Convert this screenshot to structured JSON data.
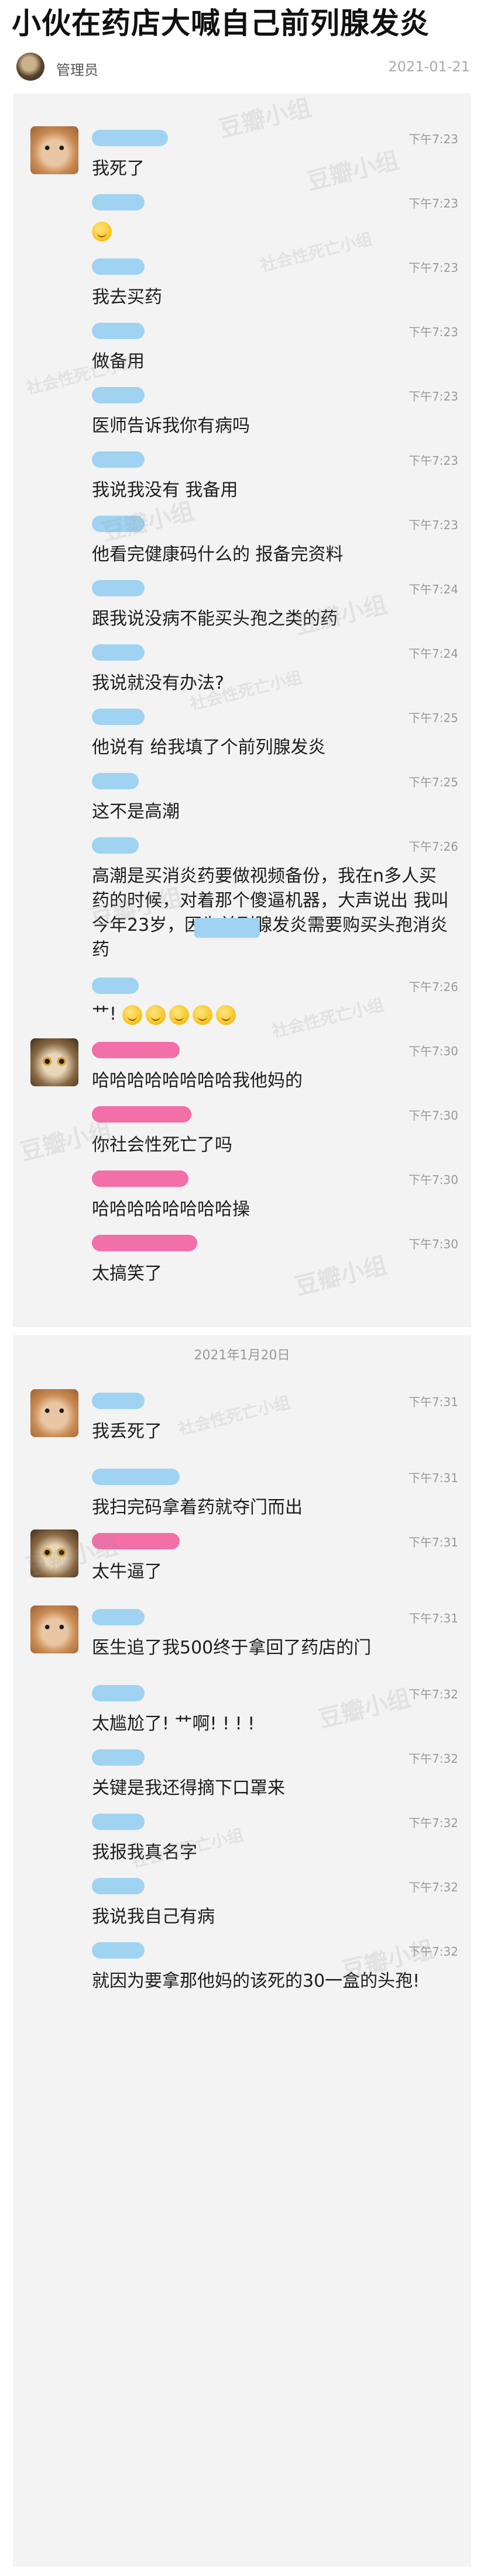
{
  "title": "小伙在药店大喊自己前列腺发炎",
  "header": {
    "author": "管理员",
    "date": "2021-01-21"
  },
  "watermark": {
    "main": "豆瓣小组",
    "sub": "社会性死亡小组"
  },
  "colors": {
    "name_blue": "#9fd3f1",
    "name_pink": "#f26fa8",
    "chat_bg": "#f3f3f3"
  },
  "day1": [
    {
      "time": "下午7:23",
      "text": "我死了"
    },
    {
      "time": "下午7:23",
      "text": ""
    },
    {
      "time": "下午7:23",
      "text": "我去买药"
    },
    {
      "time": "下午7:23",
      "text": "做备用"
    },
    {
      "time": "下午7:23",
      "text": "医师告诉我你有病吗"
    },
    {
      "time": "下午7:23",
      "text": "我说我没有  我备用"
    },
    {
      "time": "下午7:23",
      "text": "他看完健康码什么的  报备完资料"
    },
    {
      "time": "下午7:24",
      "text": "跟我说没病不能买头孢之类的药"
    },
    {
      "time": "下午7:24",
      "text": "我说就没有办法?"
    },
    {
      "time": "下午7:25",
      "text": "他说有  给我填了个前列腺发炎"
    },
    {
      "time": "下午7:25",
      "text": "这不是高潮"
    },
    {
      "time": "下午7:26",
      "text": "高潮是买消炎药要做视频备份，我在n多人买药的时候，对着那个傻逼机器，大声说出  我叫        今年23岁，因为前列腺发炎需要购买头孢消炎药"
    },
    {
      "time": "下午7:26",
      "text": "艹!"
    }
  ],
  "day1_reactions": [
    {
      "time": "下午7:30",
      "text": "哈哈哈哈哈哈哈哈我他妈的"
    },
    {
      "time": "下午7:30",
      "text": "你社会性死亡了吗"
    },
    {
      "time": "下午7:30",
      "text": "哈哈哈哈哈哈哈哈操"
    },
    {
      "time": "下午7:30",
      "text": "太搞笑了"
    }
  ],
  "day2_label": "2021年1月20日",
  "day2": [
    {
      "time": "下午7:31",
      "text": "我丢死了"
    },
    {
      "time": "下午7:31",
      "text": "我扫完码拿着药就夺门而出"
    },
    {
      "time": "下午7:31",
      "text": "太牛逼了"
    },
    {
      "time": "下午7:31",
      "text": "医生追了我500终于拿回了药店的门"
    },
    {
      "time": "下午7:32",
      "text": "太尴尬了!  艹啊!  !  !  !"
    },
    {
      "time": "下午7:32",
      "text": "关键是我还得摘下口罩来"
    },
    {
      "time": "下午7:32",
      "text": "我报我真名字"
    },
    {
      "time": "下午7:32",
      "text": "我说我自己有病"
    },
    {
      "time": "下午7:32",
      "text": "就因为要拿那他妈的该死的30一盒的头孢!"
    }
  ]
}
